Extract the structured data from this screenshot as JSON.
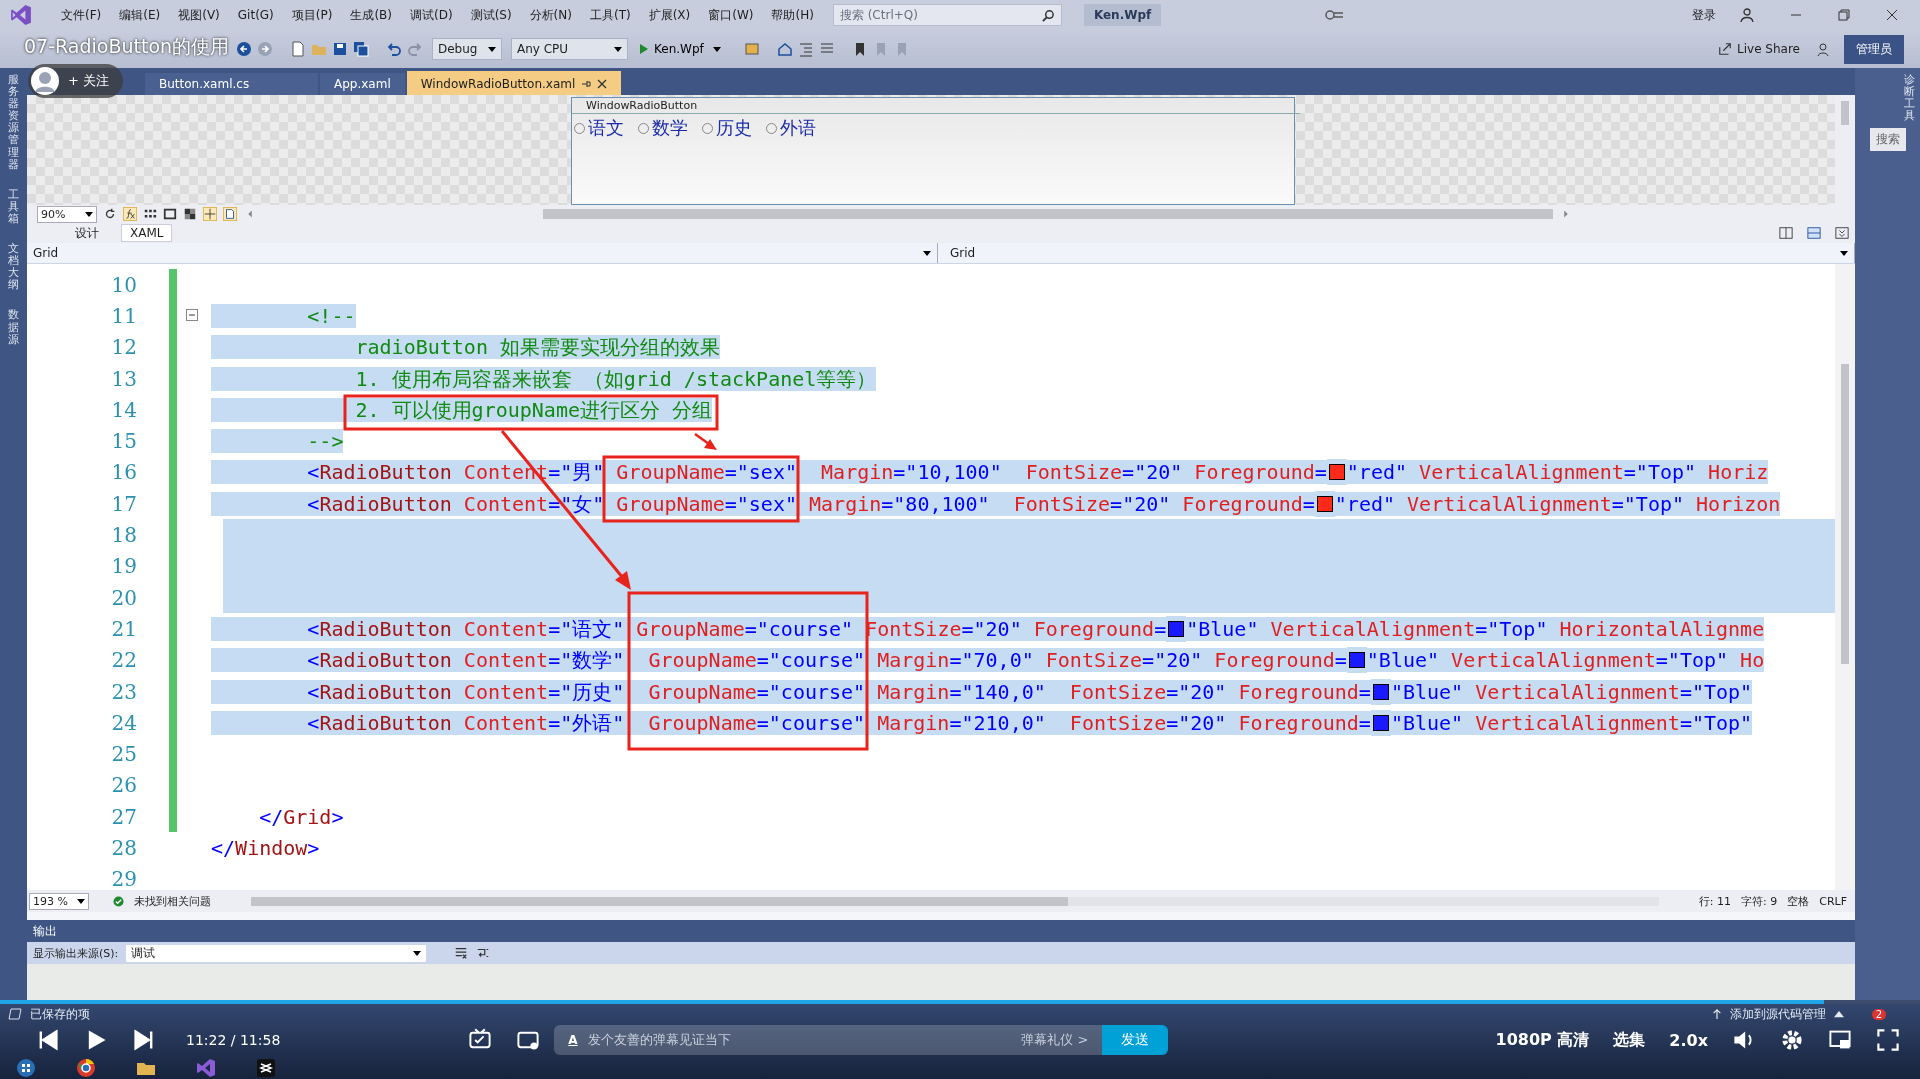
{
  "player": {
    "title": "07-RadioButton的使用",
    "follow": "+ 关注",
    "time": "11:22 / 11:58",
    "progress": {
      "level": 0.95
    },
    "danmaku_icon": "A",
    "danmaku_placeholder": "发个友善的弹幕见证当下",
    "etiquette": "弹幕礼仪 >",
    "send": "发送",
    "quality": "1080P 高清",
    "episodes": "选集",
    "speed": "2.0x"
  },
  "menu": [
    "文件(F)",
    "编辑(E)",
    "视图(V)",
    "Git(G)",
    "项目(P)",
    "生成(B)",
    "调试(D)",
    "测试(S)",
    "分析(N)",
    "工具(T)",
    "扩展(X)",
    "窗口(W)",
    "帮助(H)"
  ],
  "search": {
    "placeholder": "搜索 (Ctrl+Q)"
  },
  "solution": "Ken.Wpf",
  "account": "登录",
  "toolbar": {
    "config": "Debug",
    "platform": "Any CPU",
    "start": "Ken.Wpf",
    "live_share": "Live Share",
    "admin": "管理员"
  },
  "side_left": [
    "服务器资源管理器",
    "工具箱",
    "文档大纲",
    "数据源"
  ],
  "side_right": {
    "search": "搜索",
    "vertical": "诊断工具"
  },
  "tabs": [
    {
      "label": "Button.xaml.cs",
      "selected": false
    },
    {
      "label": "App.xaml",
      "selected": false
    },
    {
      "label": "WindowRadioButton.xaml",
      "selected": true
    }
  ],
  "designer": {
    "window_title": "WindowRadioButton",
    "radios": [
      {
        "label": "语文",
        "checked": false
      },
      {
        "label": "数学",
        "checked": false
      },
      {
        "label": "历史",
        "checked": false
      },
      {
        "label": "外语",
        "checked": false
      }
    ],
    "zoom": "90%"
  },
  "view_tabs": [
    {
      "label": "设计",
      "selected": false
    },
    {
      "label": "XAML",
      "selected": true
    }
  ],
  "nav": [
    "Grid",
    "Grid"
  ],
  "code": [
    {
      "n": "10",
      "changed": true,
      "foldable": false,
      "selected": false
    },
    {
      "n": "11",
      "changed": true,
      "foldable": true,
      "selected": true,
      "tokens": [
        {
          "kind": "comment",
          "t": "        <!--"
        }
      ]
    },
    {
      "n": "12",
      "changed": true,
      "foldable": false,
      "selected": true,
      "tokens": [
        {
          "kind": "comment",
          "t": "            radioButton 如果需要实现分组的效果"
        }
      ]
    },
    {
      "n": "13",
      "changed": true,
      "foldable": false,
      "selected": true,
      "tokens": [
        {
          "kind": "comment",
          "t": "            1. 使用布局容器来嵌套 （如grid /stackPanel等等）"
        }
      ]
    },
    {
      "n": "14",
      "changed": true,
      "foldable": false,
      "selected": true,
      "tokens": [
        {
          "kind": "comment",
          "t": "            2. 可以使用groupName进行区分 分组"
        }
      ]
    },
    {
      "n": "15",
      "changed": true,
      "foldable": false,
      "selected": true,
      "tokens": [
        {
          "kind": "comment",
          "t": "        -->"
        }
      ]
    },
    {
      "n": "16",
      "changed": true,
      "foldable": false,
      "selected": true,
      "tokens": [
        {
          "kind": "punct",
          "t": "        <"
        },
        {
          "kind": "tag",
          "t": "RadioButton"
        },
        {
          "kind": "attr",
          "t": " Content"
        },
        {
          "kind": "punct",
          "t": "="
        },
        {
          "kind": "value",
          "t": "\"男\""
        },
        {
          "kind": "attr",
          "t": " GroupName"
        },
        {
          "kind": "punct",
          "t": "="
        },
        {
          "kind": "value",
          "t": "\"sex\""
        },
        {
          "kind": "attr",
          "t": "  Margin"
        },
        {
          "kind": "punct",
          "t": "="
        },
        {
          "kind": "value",
          "t": "\"10,100\""
        },
        {
          "kind": "attr",
          "t": "  FontSize"
        },
        {
          "kind": "punct",
          "t": "="
        },
        {
          "kind": "value",
          "t": "\"20\""
        },
        {
          "kind": "attr",
          "t": " Foreground"
        },
        {
          "kind": "punct",
          "t": "="
        },
        {
          "kind": "swatch",
          "color": "#ff2a1a"
        },
        {
          "kind": "value",
          "t": "\"red\""
        },
        {
          "kind": "attr",
          "t": " VerticalAlignment"
        },
        {
          "kind": "punct",
          "t": "="
        },
        {
          "kind": "value",
          "t": "\"Top\""
        },
        {
          "kind": "attr",
          "t": " Horiz"
        }
      ]
    },
    {
      "n": "17",
      "changed": true,
      "foldable": false,
      "selected": true,
      "tokens": [
        {
          "kind": "punct",
          "t": "        <"
        },
        {
          "kind": "tag",
          "t": "RadioButton"
        },
        {
          "kind": "attr",
          "t": " Content"
        },
        {
          "kind": "punct",
          "t": "="
        },
        {
          "kind": "value",
          "t": "\"女\""
        },
        {
          "kind": "attr",
          "t": " GroupName"
        },
        {
          "kind": "punct",
          "t": "="
        },
        {
          "kind": "value",
          "t": "\"sex\""
        },
        {
          "kind": "attr",
          "t": " Margin"
        },
        {
          "kind": "punct",
          "t": "="
        },
        {
          "kind": "value",
          "t": "\"80,100\""
        },
        {
          "kind": "attr",
          "t": "  FontSize"
        },
        {
          "kind": "punct",
          "t": "="
        },
        {
          "kind": "value",
          "t": "\"20\""
        },
        {
          "kind": "attr",
          "t": " Foreground"
        },
        {
          "kind": "punct",
          "t": "="
        },
        {
          "kind": "swatch",
          "color": "#ff2a1a"
        },
        {
          "kind": "value",
          "t": "\"red\""
        },
        {
          "kind": "attr",
          "t": " VerticalAlignment"
        },
        {
          "kind": "punct",
          "t": "="
        },
        {
          "kind": "value",
          "t": "\"Top\""
        },
        {
          "kind": "attr",
          "t": " Horizon"
        }
      ]
    },
    {
      "n": "18",
      "changed": true,
      "foldable": false,
      "selected": true
    },
    {
      "n": "19",
      "changed": true,
      "foldable": false,
      "selected": true
    },
    {
      "n": "20",
      "changed": true,
      "foldable": false,
      "selected": true
    },
    {
      "n": "21",
      "changed": true,
      "foldable": false,
      "selected": true,
      "tokens": [
        {
          "kind": "punct",
          "t": "        <"
        },
        {
          "kind": "tag",
          "t": "RadioButton"
        },
        {
          "kind": "attr",
          "t": " Content"
        },
        {
          "kind": "punct",
          "t": "="
        },
        {
          "kind": "value",
          "t": "\"语文\""
        },
        {
          "kind": "attr",
          "t": " GroupName"
        },
        {
          "kind": "punct",
          "t": "="
        },
        {
          "kind": "value",
          "t": "\"course\""
        },
        {
          "kind": "attr",
          "t": " FontSize"
        },
        {
          "kind": "punct",
          "t": "="
        },
        {
          "kind": "value",
          "t": "\"20\""
        },
        {
          "kind": "attr",
          "t": " Foreground"
        },
        {
          "kind": "punct",
          "t": "="
        },
        {
          "kind": "swatch",
          "color": "#1a1aff"
        },
        {
          "kind": "value",
          "t": "\"Blue\""
        },
        {
          "kind": "attr",
          "t": " VerticalAlignment"
        },
        {
          "kind": "punct",
          "t": "="
        },
        {
          "kind": "value",
          "t": "\"Top\""
        },
        {
          "kind": "attr",
          "t": " HorizontalAlignme"
        }
      ]
    },
    {
      "n": "22",
      "changed": true,
      "foldable": false,
      "selected": true,
      "tokens": [
        {
          "kind": "punct",
          "t": "        <"
        },
        {
          "kind": "tag",
          "t": "RadioButton"
        },
        {
          "kind": "attr",
          "t": " Content"
        },
        {
          "kind": "punct",
          "t": "="
        },
        {
          "kind": "value",
          "t": "\"数学\""
        },
        {
          "kind": "attr",
          "t": "  GroupName"
        },
        {
          "kind": "punct",
          "t": "="
        },
        {
          "kind": "value",
          "t": "\"course\""
        },
        {
          "kind": "attr",
          "t": " Margin"
        },
        {
          "kind": "punct",
          "t": "="
        },
        {
          "kind": "value",
          "t": "\"70,0\""
        },
        {
          "kind": "attr",
          "t": " FontSize"
        },
        {
          "kind": "punct",
          "t": "="
        },
        {
          "kind": "value",
          "t": "\"20\""
        },
        {
          "kind": "attr",
          "t": " Foreground"
        },
        {
          "kind": "punct",
          "t": "="
        },
        {
          "kind": "swatch",
          "color": "#1a1aff"
        },
        {
          "kind": "value",
          "t": "\"Blue\""
        },
        {
          "kind": "attr",
          "t": " VerticalAlignment"
        },
        {
          "kind": "punct",
          "t": "="
        },
        {
          "kind": "value",
          "t": "\"Top\""
        },
        {
          "kind": "attr",
          "t": " Ho"
        }
      ]
    },
    {
      "n": "23",
      "changed": true,
      "foldable": false,
      "selected": true,
      "tokens": [
        {
          "kind": "punct",
          "t": "        <"
        },
        {
          "kind": "tag",
          "t": "RadioButton"
        },
        {
          "kind": "attr",
          "t": " Content"
        },
        {
          "kind": "punct",
          "t": "="
        },
        {
          "kind": "value",
          "t": "\"历史\""
        },
        {
          "kind": "attr",
          "t": "  GroupName"
        },
        {
          "kind": "punct",
          "t": "="
        },
        {
          "kind": "value",
          "t": "\"course\""
        },
        {
          "kind": "attr",
          "t": " Margin"
        },
        {
          "kind": "punct",
          "t": "="
        },
        {
          "kind": "value",
          "t": "\"140,0\""
        },
        {
          "kind": "attr",
          "t": "  FontSize"
        },
        {
          "kind": "punct",
          "t": "="
        },
        {
          "kind": "value",
          "t": "\"20\""
        },
        {
          "kind": "attr",
          "t": " Foreground"
        },
        {
          "kind": "punct",
          "t": "="
        },
        {
          "kind": "swatch",
          "color": "#1a1aff"
        },
        {
          "kind": "value",
          "t": "\"Blue\""
        },
        {
          "kind": "attr",
          "t": " VerticalAlignment"
        },
        {
          "kind": "punct",
          "t": "="
        },
        {
          "kind": "value",
          "t": "\"Top\""
        }
      ]
    },
    {
      "n": "24",
      "changed": true,
      "foldable": false,
      "selected": true,
      "tokens": [
        {
          "kind": "punct",
          "t": "        <"
        },
        {
          "kind": "tag",
          "t": "RadioButton"
        },
        {
          "kind": "attr",
          "t": " Content"
        },
        {
          "kind": "punct",
          "t": "="
        },
        {
          "kind": "value",
          "t": "\"外语\""
        },
        {
          "kind": "attr",
          "t": "  GroupName"
        },
        {
          "kind": "punct",
          "t": "="
        },
        {
          "kind": "value",
          "t": "\"course\""
        },
        {
          "kind": "attr",
          "t": " Margin"
        },
        {
          "kind": "punct",
          "t": "="
        },
        {
          "kind": "value",
          "t": "\"210,0\""
        },
        {
          "kind": "attr",
          "t": "  FontSize"
        },
        {
          "kind": "punct",
          "t": "="
        },
        {
          "kind": "value",
          "t": "\"20\""
        },
        {
          "kind": "attr",
          "t": " Foreground"
        },
        {
          "kind": "punct",
          "t": "="
        },
        {
          "kind": "swatch",
          "color": "#1a1aff"
        },
        {
          "kind": "value",
          "t": "\"Blue\""
        },
        {
          "kind": "attr",
          "t": " VerticalAlignment"
        },
        {
          "kind": "punct",
          "t": "="
        },
        {
          "kind": "value",
          "t": "\"Top\""
        }
      ]
    },
    {
      "n": "25",
      "changed": true,
      "foldable": false,
      "selected": false
    },
    {
      "n": "26",
      "changed": true,
      "foldable": false,
      "selected": false
    },
    {
      "n": "27",
      "changed": true,
      "foldable": false,
      "selected": false,
      "tokens": [
        {
          "kind": "punct",
          "t": "    </"
        },
        {
          "kind": "tag",
          "t": "Grid"
        },
        {
          "kind": "punct",
          "t": ">"
        }
      ]
    },
    {
      "n": "28",
      "changed": false,
      "foldable": false,
      "selected": false,
      "tokens": [
        {
          "kind": "punct",
          "t": "</"
        },
        {
          "kind": "tag",
          "t": "Window"
        },
        {
          "kind": "punct",
          "t": ">"
        }
      ]
    },
    {
      "n": "29",
      "changed": false,
      "foldable": false,
      "selected": false
    }
  ],
  "status": {
    "zoom": "193 %",
    "issues": "未找到相关问题",
    "line": "行: 11",
    "char": "字符: 9",
    "indent": "空格",
    "eol": "CRLF"
  },
  "output": {
    "title": "输出",
    "source_label": "显示输出来源(S):",
    "source": "调试"
  },
  "vs_status": {
    "left": "已保存的项",
    "right": "添加到源代码管理",
    "badge": "2"
  }
}
